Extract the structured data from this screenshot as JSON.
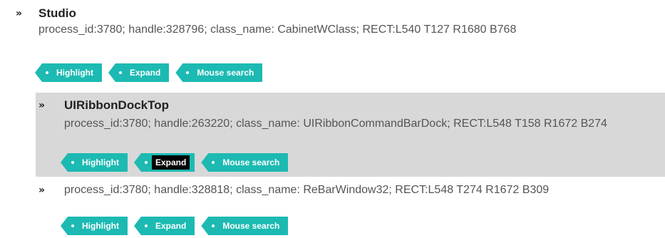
{
  "colors": {
    "button_bg": "#1cbab2",
    "selected_bg": "#d8d8d8",
    "text": "#555555"
  },
  "icons": {
    "expander": "double-chevron-right-icon",
    "button_bullet": "dot-icon"
  },
  "chevron": "»",
  "nodes": [
    {
      "title": "Studio",
      "info": "process_id:3780; handle:328796; class_name: CabinetWClass; RECT:L540 T127 R1680 B768",
      "buttons": [
        "Highlight",
        "Expand",
        "Mouse search"
      ]
    },
    {
      "title": "UIRibbonDockTop",
      "info": "process_id:3780; handle:263220; class_name: UIRibbonCommandBarDock; RECT:L548 T158 R1672 B274",
      "buttons": [
        "Highlight",
        "Expand",
        "Mouse search"
      ],
      "selected": true,
      "focused_button": "Expand"
    },
    {
      "title": "",
      "info": "process_id:3780; handle:328818; class_name: ReBarWindow32; RECT:L548 T274 R1672 B309",
      "buttons": [
        "Highlight",
        "Expand",
        "Mouse search"
      ]
    }
  ]
}
